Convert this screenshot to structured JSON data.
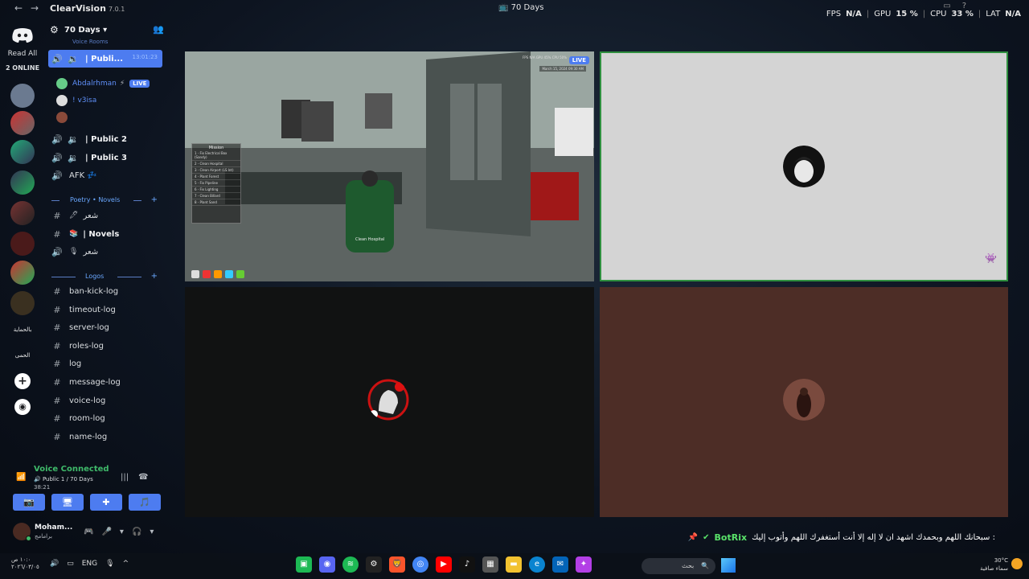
{
  "titlebar": {
    "app_name": "ClearVision",
    "version": "7.0.1",
    "window_title": "70 Days",
    "stats": {
      "fps_label": "FPS",
      "fps_value": "N/A",
      "gpu_label": "GPU",
      "gpu_value": "15 %",
      "cpu_label": "CPU",
      "cpu_value": "33 %",
      "lat_label": "LAT",
      "lat_value": "N/A"
    }
  },
  "rail": {
    "read_all": "Read All",
    "online": "2 ONLINE",
    "server_text_1": "بالحماية",
    "server_text_2": "الحمى"
  },
  "guild": {
    "name": "70 Days",
    "voice_category": "Voice Rooms",
    "voice_channels": [
      {
        "label": "| Publi...",
        "time": "13:01:23"
      },
      {
        "label": "| Public 2"
      },
      {
        "label": "| Public 3"
      },
      {
        "label": "AFK 💤"
      }
    ],
    "voice_users": [
      {
        "name": "Abdalrhman",
        "live": "LIVE"
      },
      {
        "name": "! v3isa"
      },
      {
        "name": ""
      }
    ],
    "poetry_category": "Poetry • Novels",
    "poetry_channels": [
      {
        "label": "شعر",
        "emoji": "🖊"
      },
      {
        "label": "| Novels",
        "emoji": "📚"
      },
      {
        "label": "شعر",
        "emoji": "🎙"
      }
    ],
    "logs_category": "Logos",
    "log_channels": [
      "ban-kick-log",
      "timeout-log",
      "server-log",
      "roles-log",
      "log",
      "message-log",
      "voice-log",
      "room-log",
      "name-log"
    ]
  },
  "voice_panel": {
    "status": "Voice Connected",
    "channel": "Public 1 / 70 Days",
    "duration": "38:21"
  },
  "user": {
    "name": "Moham...",
    "status": "برامامج"
  },
  "video": {
    "live_label": "LIVE",
    "game_menu_title": "Mission",
    "game_menu_items": [
      "1 - Fix Electrical Box (Sandy)",
      "2 - Clean Hospital",
      "3 - Clean Airport (LS Int)",
      "4 - Plant Forest",
      "5 - Fix Pipeline",
      "6 - Fix Lighting",
      "7 - Clean Billard",
      "8 - Plant Sand"
    ],
    "game_prompt": "Clean Hospital",
    "game_stats": "FPS N/A   GPU 45%   CPU 50%",
    "game_date": "March 15, 2024 09:30 AM"
  },
  "ticker": {
    "bot_name": "BotRix",
    "message": "سبحانك اللهم وبحمدك اشهد ان لا إله إلا أنت أستغفرك اللهم وأتوب إليك :"
  },
  "taskbar": {
    "time": "١٠:٠ ص",
    "date": "٢٠٢٦/٠٣/٠٥",
    "lang": "ENG",
    "search_placeholder": "بحث",
    "temperature": "30°C",
    "weather": "سماء صافية"
  },
  "colors": {
    "accent": "#4d7cf0",
    "online": "#3fba6a",
    "speaking_border": "#2f8f3f",
    "bot_name": "#5ae36a"
  }
}
